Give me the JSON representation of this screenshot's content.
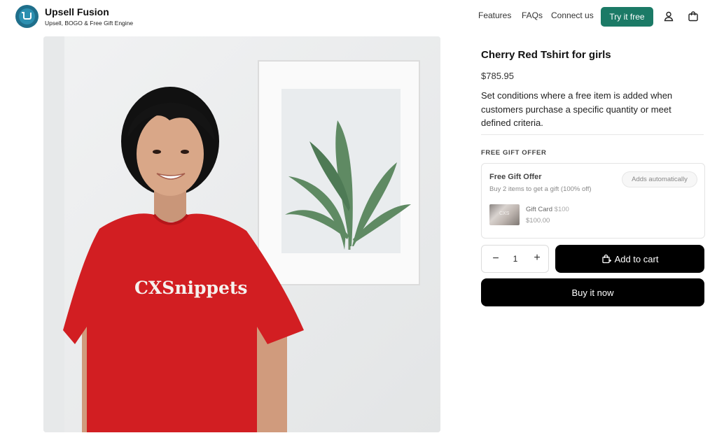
{
  "header": {
    "brand_title": "Upsell Fusion",
    "brand_subtitle": "Upsell, BOGO & Free Gift Engine",
    "nav": [
      "Features",
      "FAQs",
      "Connect us"
    ],
    "cta_label": "Try it free",
    "icons": [
      "user-icon",
      "bag-icon"
    ],
    "accent_color": "#1b7a66"
  },
  "product": {
    "image_shirt_text": "CXSnippets",
    "title": "Cherry Red Tshirt for girls",
    "price": "$785.95",
    "description": "Set conditions where a free item is added when customers purchase a specific quantity or meet defined criteria."
  },
  "offer": {
    "section_label": "FREE GIFT OFFER",
    "title": "Free Gift Offer",
    "subtitle": "Buy 2 items to get a gift (100% off)",
    "badge": "Adds automatically",
    "gift_thumb_text": "CXS",
    "gift_name": "Gift Card",
    "gift_original_price": "$100",
    "gift_price": "$100.00"
  },
  "purchase": {
    "qty_minus": "−",
    "quantity": "1",
    "qty_plus": "+",
    "add_to_cart": "Add to cart",
    "buy_now": "Buy it now"
  }
}
